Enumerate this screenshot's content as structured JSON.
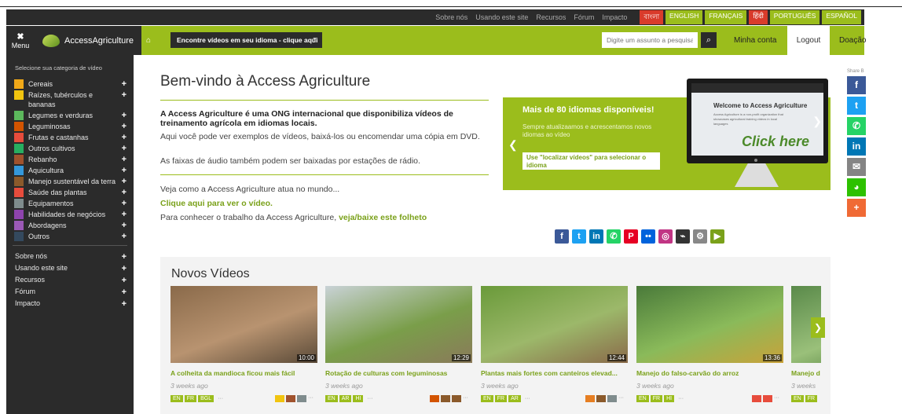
{
  "topbar": {
    "links": [
      "Sobre nós",
      "Usando este site",
      "Recursos",
      "Fórum",
      "Impacto"
    ],
    "languages": [
      {
        "label": "বাংলা",
        "active": true
      },
      {
        "label": "ENGLISH",
        "active": false
      },
      {
        "label": "FRANÇAIS",
        "active": false
      },
      {
        "label": "हिंदी",
        "active": true
      },
      {
        "label": "PORTUGUÊS",
        "active": false
      },
      {
        "label": "ESPAÑOL",
        "active": false
      }
    ]
  },
  "header": {
    "menu_label": "Menu",
    "logo_text": "AccessAgriculture",
    "lang_select": "Encontre vídeos em seu idioma - clique aqui",
    "search_placeholder": "Digite um assunto a pesquisar...",
    "account": "Minha conta",
    "logout": "Logout",
    "donate": "Doação"
  },
  "sidebar": {
    "title": "Selecione sua categoria de vídeo",
    "categories": [
      {
        "label": "Cereais",
        "color": "#f0a818"
      },
      {
        "label": "Raízes, tubérculos e bananas",
        "color": "#f1c40f"
      },
      {
        "label": "Legumes e verduras",
        "color": "#5cb85c"
      },
      {
        "label": "Leguminosas",
        "color": "#d35400"
      },
      {
        "label": "Frutas e castanhas",
        "color": "#e74c3c"
      },
      {
        "label": "Outros cultivos",
        "color": "#27ae60"
      },
      {
        "label": "Rebanho",
        "color": "#a0522d"
      },
      {
        "label": "Aquicultura",
        "color": "#3498db"
      },
      {
        "label": "Manejo sustentável da terra",
        "color": "#8b5a2b"
      },
      {
        "label": "Saúde das plantas",
        "color": "#e74c3c"
      },
      {
        "label": "Equipamentos",
        "color": "#7f8c8d"
      },
      {
        "label": "Habilidades de negócios",
        "color": "#8e44ad"
      },
      {
        "label": "Abordagens",
        "color": "#9b59b6"
      },
      {
        "label": "Outros",
        "color": "#34495e"
      }
    ],
    "links": [
      "Sobre nós",
      "Usando este site",
      "Recursos",
      "Fórum",
      "Impacto"
    ]
  },
  "main": {
    "title": "Bem-vindo à Access Agriculture",
    "intro_bold": "A Access Agriculture é uma ONG internacional que disponibiliza vídeos de treinamento agrícola em idiomas locais.",
    "intro_p1": "Aqui você pode ver exemplos de vídeos, baixá-los ou encomendar uma cópia em DVD.",
    "intro_p2": "As faixas de áudio também podem ser baixadas por estações de rádio.",
    "see_text": "Veja como a Access Agriculture atua no mundo...",
    "click_here": "Clique aqui para ver o vídeo.",
    "brochure_text": "Para conhecer o trabalho da Access Agriculture, ",
    "brochure_link": "veja/baixe este folheto"
  },
  "promo": {
    "title": "Mais de 80 idiomas disponíveis!",
    "subtitle": "Sempre atualizaamos e acrescentamos novos idiomas ao vídeo",
    "button": "Use \"localizar vídeos\" para selecionar o idioma",
    "screen_title": "Welcome to Access Agriculture",
    "screen_text": "Access Agriculture is a non-profit organization that showcases agricultural training videos in local languages",
    "click_here": "Click here"
  },
  "social_icons": [
    {
      "icon": "facebook-icon",
      "glyph": "f",
      "color": "#3b5998"
    },
    {
      "icon": "twitter-icon",
      "glyph": "t",
      "color": "#1da1f2"
    },
    {
      "icon": "linkedin-icon",
      "glyph": "in",
      "color": "#0077b5"
    },
    {
      "icon": "whatsapp-icon",
      "glyph": "✆",
      "color": "#25d366"
    },
    {
      "icon": "pinterest-icon",
      "glyph": "P",
      "color": "#e60023"
    },
    {
      "icon": "flickr-icon",
      "glyph": "••",
      "color": "#0063dc"
    },
    {
      "icon": "instagram-icon",
      "glyph": "◎",
      "color": "#c13584"
    },
    {
      "icon": "radio-icon",
      "glyph": "⌁",
      "color": "#333333"
    },
    {
      "icon": "gears-icon",
      "glyph": "⚙",
      "color": "#888888"
    },
    {
      "icon": "youtube-icon",
      "glyph": "▶",
      "color": "#7aa11a"
    }
  ],
  "novos_videos": {
    "title": "Novos Vídeos",
    "videos": [
      {
        "title": "A colheita da mandioca ficou mais fácil",
        "date": "3 weeks ago",
        "duration": "10:00",
        "langs": [
          "EN",
          "FR",
          "BGL"
        ],
        "thumb": [
          "#8a6a4a",
          "#b89370",
          "#5a4a38"
        ],
        "cats": [
          "#f1c40f",
          "#a0522d",
          "#7f8c8d"
        ]
      },
      {
        "title": "Rotação de culturas com leguminosas",
        "date": "3 weeks ago",
        "duration": "12:29",
        "langs": [
          "EN",
          "AR",
          "HI"
        ],
        "thumb": [
          "#c9d2d6",
          "#7a9e4a",
          "#8a7a5a"
        ],
        "cats": [
          "#d35400",
          "#8b5a2b",
          "#8b5a2b"
        ]
      },
      {
        "title": "Plantas mais fortes com canteiros elevad...",
        "date": "3 weeks ago",
        "duration": "12:44",
        "langs": [
          "EN",
          "FR",
          "AR"
        ],
        "thumb": [
          "#6a9a3a",
          "#9cb86a",
          "#8a6a4a"
        ],
        "cats": [
          "#e67e22",
          "#8b5a2b",
          "#7f8c8d"
        ]
      },
      {
        "title": "Manejo do falso-carvão do arroz",
        "date": "3 weeks ago",
        "duration": "13:36",
        "langs": [
          "EN",
          "FR",
          "HI"
        ],
        "thumb": [
          "#4a7a3a",
          "#8aba5a",
          "#c9a23a"
        ],
        "cats": [
          "#e74c3c",
          "#e74c3c"
        ]
      },
      {
        "title": "Manejo d",
        "date": "3 weeks",
        "duration": "",
        "langs": [
          "EN",
          "FR"
        ],
        "thumb": [
          "#5a8a4a",
          "#9ac07a",
          "#3a6a2a"
        ],
        "cats": []
      }
    ]
  },
  "sharebar": {
    "label": "Share B",
    "items": [
      {
        "icon": "facebook-icon",
        "glyph": "f",
        "color": "#3b5998"
      },
      {
        "icon": "twitter-icon",
        "glyph": "t",
        "color": "#1da1f2"
      },
      {
        "icon": "whatsapp-icon",
        "glyph": "✆",
        "color": "#25d366"
      },
      {
        "icon": "linkedin-icon",
        "glyph": "in",
        "color": "#0077b5"
      },
      {
        "icon": "email-icon",
        "glyph": "✉",
        "color": "#848484"
      },
      {
        "icon": "wechat-icon",
        "glyph": "◕",
        "color": "#2dc100"
      },
      {
        "icon": "more-icon",
        "glyph": "+",
        "color": "#f06a35"
      }
    ]
  },
  "colors": {
    "accent": "#9bbd1c",
    "dark": "#2b2b2b",
    "link": "#7aa11a"
  }
}
